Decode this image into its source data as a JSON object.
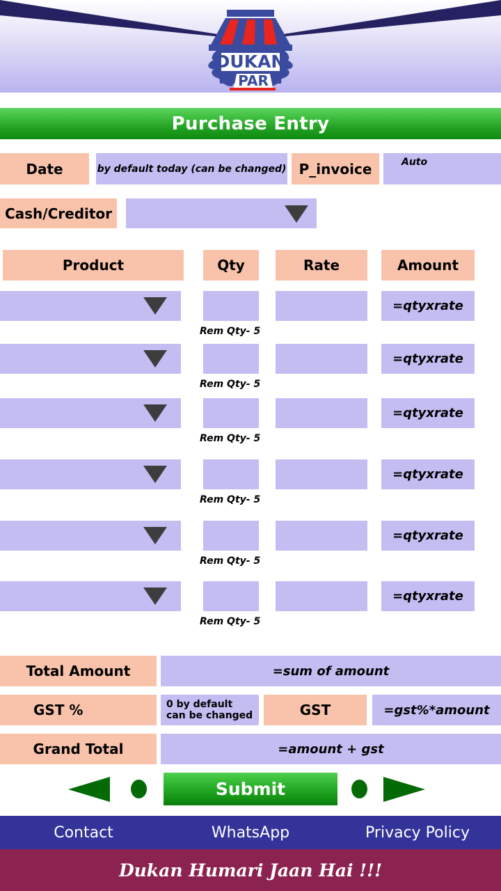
{
  "brand": {
    "logo_line1": "DUKAN",
    "logo_line2": "PAR"
  },
  "header": {
    "title": "Purchase Entry"
  },
  "top_form": {
    "date_label": "Date",
    "date_value": "by default today (can be changed)",
    "invoice_label": "P_invoice",
    "invoice_value": "Auto",
    "party_label": "Cash/Creditor",
    "party_value": ""
  },
  "table": {
    "headers": {
      "product": "Product",
      "qty": "Qty",
      "rate": "Rate",
      "amount": "Amount"
    },
    "rows": [
      {
        "product": "",
        "qty": "",
        "rate": "",
        "amount": "=qtyxrate",
        "rem_qty": "Rem Qty- 5"
      },
      {
        "product": "",
        "qty": "",
        "rate": "",
        "amount": "=qtyxrate",
        "rem_qty": "Rem Qty- 5"
      },
      {
        "product": "",
        "qty": "",
        "rate": "",
        "amount": "=qtyxrate",
        "rem_qty": "Rem Qty- 5"
      },
      {
        "product": "",
        "qty": "",
        "rate": "",
        "amount": "=qtyxrate",
        "rem_qty": "Rem Qty- 5"
      },
      {
        "product": "",
        "qty": "",
        "rate": "",
        "amount": "=qtyxrate",
        "rem_qty": "Rem Qty- 5"
      },
      {
        "product": "",
        "qty": "",
        "rate": "",
        "amount": "=qtyxrate",
        "rem_qty": "Rem Qty- 5"
      }
    ]
  },
  "totals": {
    "total_amount_label": "Total Amount",
    "total_amount_value": "=sum of amount",
    "gst_percent_label": "GST %",
    "gst_percent_value": "0 by default\ncan be changed",
    "gst_percent_value_line1": "0 by default",
    "gst_percent_value_line2": "can be changed",
    "gst_label": "GST",
    "gst_value": "=gst%*amount",
    "grand_total_label": "Grand Total",
    "grand_total_value": "=amount + gst"
  },
  "actions": {
    "previous": "previous-arrow",
    "next": "next-arrow",
    "submit": "Submit"
  },
  "footer": {
    "links": [
      {
        "label": "Contact"
      },
      {
        "label": "WhatsApp"
      },
      {
        "label": "Privacy Policy"
      }
    ],
    "tagline": "Dukan Humari Jaan Hai !!!"
  },
  "colors": {
    "label_peach": "#f9c3ab",
    "field_lavender": "#c3bdf2",
    "title_green": "#23a223",
    "footer_navy": "#333399",
    "footer_maroon": "#8C2250",
    "logo_blue": "#3a4a9f",
    "logo_red": "#e8251f"
  }
}
